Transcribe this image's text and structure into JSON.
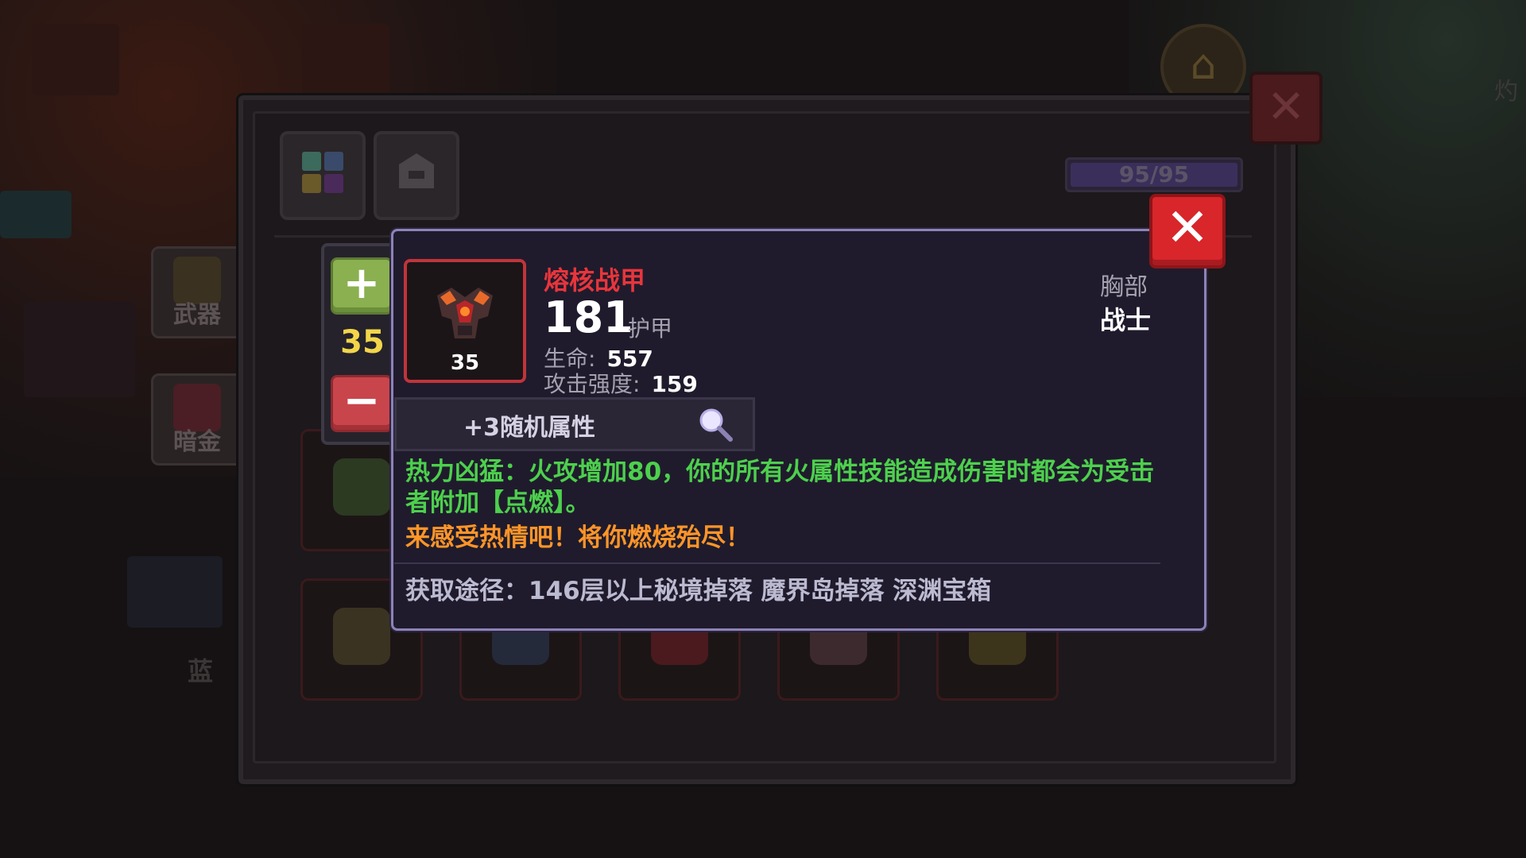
{
  "background": {
    "side_tabs": [
      {
        "label": "武器"
      },
      {
        "label": "暗金"
      }
    ],
    "bottom_left_text": "蓝",
    "right_edge_text": "灼"
  },
  "inventory": {
    "capacity": "95/95",
    "close_symbol": "✕",
    "filter_icons": [
      "grid-icon",
      "helmet-icon"
    ]
  },
  "stepper": {
    "plus_symbol": "+",
    "minus_symbol": "−",
    "level": "35"
  },
  "item": {
    "name": "熔核战甲",
    "level": "35",
    "armor_value": "181",
    "armor_label": "护甲",
    "stats": [
      {
        "key": "生命:",
        "value": "557"
      },
      {
        "key": "攻击强度:",
        "value": "159"
      }
    ],
    "slot_type": "胸部",
    "class_type": "战士",
    "random_attributes": "+3随机属性",
    "effect": "热力凶猛：火攻增加80，你的所有火属性技能造成伤害时都会为受击者附加【点燃】。",
    "flavor": "来感受热情吧！将你燃烧殆尽！",
    "source": "获取途径：146层以上秘境掉落 魔界岛掉落 深渊宝箱",
    "close_symbol": "✕",
    "name_color": "#e8353c",
    "effect_color": "#4dd04d",
    "flavor_color": "#ff9528"
  }
}
